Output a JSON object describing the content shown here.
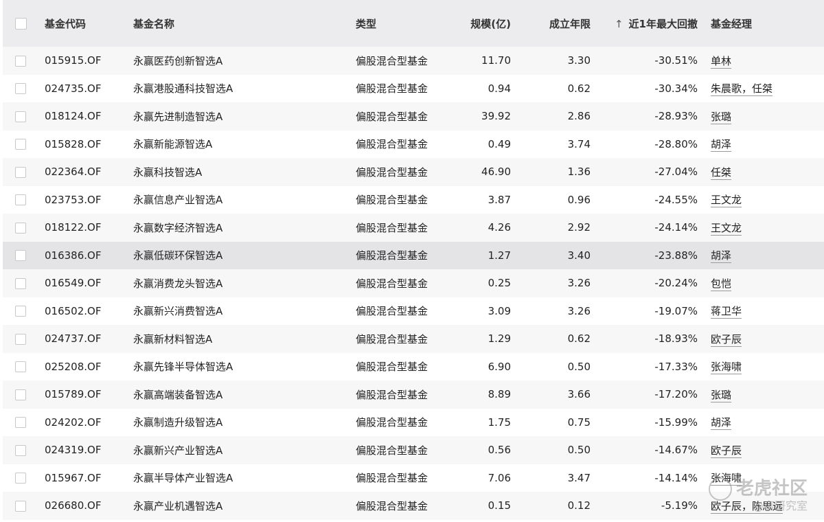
{
  "table": {
    "headers": {
      "code": "基金代码",
      "name": "基金名称",
      "type": "类型",
      "scale": "规模(亿)",
      "years": "成立年限",
      "drawdown_sort_icon": "↑",
      "drawdown": "近1年最大回撤",
      "manager": "基金经理"
    },
    "rows": [
      {
        "code": "015915.OF",
        "name": "永赢医药创新智选A",
        "type": "偏股混合型基金",
        "scale": "11.70",
        "years": "3.30",
        "drawdown": "-30.51%",
        "manager": "单林"
      },
      {
        "code": "024735.OF",
        "name": "永赢港股通科技智选A",
        "type": "偏股混合型基金",
        "scale": "0.94",
        "years": "0.62",
        "drawdown": "-30.34%",
        "manager": "朱晨歌，任桀"
      },
      {
        "code": "018124.OF",
        "name": "永赢先进制造智选A",
        "type": "偏股混合型基金",
        "scale": "39.92",
        "years": "2.86",
        "drawdown": "-28.93%",
        "manager": "张璐"
      },
      {
        "code": "015828.OF",
        "name": "永赢新能源智选A",
        "type": "偏股混合型基金",
        "scale": "0.49",
        "years": "3.74",
        "drawdown": "-28.80%",
        "manager": "胡泽"
      },
      {
        "code": "022364.OF",
        "name": "永赢科技智选A",
        "type": "偏股混合型基金",
        "scale": "46.90",
        "years": "1.36",
        "drawdown": "-27.04%",
        "manager": "任桀"
      },
      {
        "code": "023753.OF",
        "name": "永赢信息产业智选A",
        "type": "偏股混合型基金",
        "scale": "3.87",
        "years": "0.96",
        "drawdown": "-24.55%",
        "manager": "王文龙"
      },
      {
        "code": "018122.OF",
        "name": "永赢数字经济智选A",
        "type": "偏股混合型基金",
        "scale": "4.26",
        "years": "2.92",
        "drawdown": "-24.14%",
        "manager": "王文龙"
      },
      {
        "code": "016386.OF",
        "name": "永赢低碳环保智选A",
        "type": "偏股混合型基金",
        "scale": "1.27",
        "years": "3.40",
        "drawdown": "-23.88%",
        "manager": "胡泽"
      },
      {
        "code": "016549.OF",
        "name": "永赢消费龙头智选A",
        "type": "偏股混合型基金",
        "scale": "0.25",
        "years": "3.26",
        "drawdown": "-20.24%",
        "manager": "包恺"
      },
      {
        "code": "016502.OF",
        "name": "永赢新兴消费智选A",
        "type": "偏股混合型基金",
        "scale": "3.09",
        "years": "3.26",
        "drawdown": "-19.07%",
        "manager": "蒋卫华"
      },
      {
        "code": "024737.OF",
        "name": "永赢新材料智选A",
        "type": "偏股混合型基金",
        "scale": "1.29",
        "years": "0.62",
        "drawdown": "-18.93%",
        "manager": "欧子辰"
      },
      {
        "code": "025208.OF",
        "name": "永赢先锋半导体智选A",
        "type": "偏股混合型基金",
        "scale": "6.90",
        "years": "0.50",
        "drawdown": "-17.33%",
        "manager": "张海啸"
      },
      {
        "code": "015789.OF",
        "name": "永赢高端装备智选A",
        "type": "偏股混合型基金",
        "scale": "8.89",
        "years": "3.66",
        "drawdown": "-17.20%",
        "manager": "张璐"
      },
      {
        "code": "024202.OF",
        "name": "永赢制造升级智选A",
        "type": "偏股混合型基金",
        "scale": "1.75",
        "years": "0.75",
        "drawdown": "-15.99%",
        "manager": "胡泽"
      },
      {
        "code": "024319.OF",
        "name": "永赢新兴产业智选A",
        "type": "偏股混合型基金",
        "scale": "0.56",
        "years": "0.50",
        "drawdown": "-14.67%",
        "manager": "欧子辰"
      },
      {
        "code": "015967.OF",
        "name": "永赢半导体产业智选A",
        "type": "偏股混合型基金",
        "scale": "7.06",
        "years": "3.47",
        "drawdown": "-14.14%",
        "manager": "张海啸"
      },
      {
        "code": "026680.OF",
        "name": "永赢产业机遇智选A",
        "type": "偏股混合型基金",
        "scale": "0.15",
        "years": "0.12",
        "drawdown": "-5.19%",
        "manager": "欧子辰，陈思远"
      }
    ],
    "highlighted_row_index": 7
  },
  "watermark": {
    "title": "老虎社区",
    "subtitle": "@富研究室"
  },
  "colors": {
    "header_bg": "#ececee",
    "stripe_bg": "#f7f7f7",
    "highlight_bg": "#e4e4e7"
  }
}
